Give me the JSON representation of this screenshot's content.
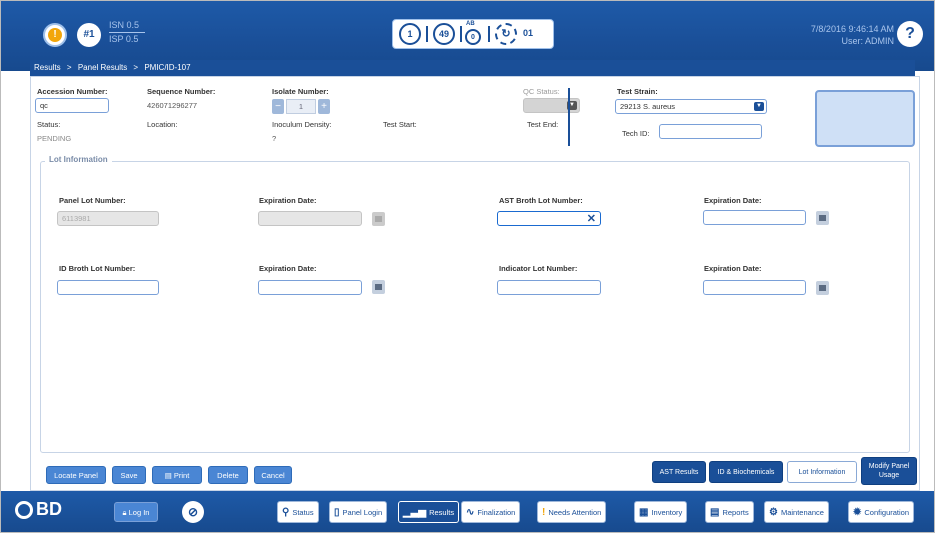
{
  "topbar": {
    "queue_number": "#1",
    "isn_label": "ISN 0.5",
    "isp_label": "ISP 0.5",
    "status_1": "1",
    "status_49": "49",
    "ab_label": "AB",
    "ab_value": "0",
    "instrument_value": "01",
    "datetime": "7/8/2016 9:46:14 AM",
    "user": "User: ADMIN",
    "help_label": "?"
  },
  "breadcrumb": [
    "Results",
    ">",
    "Panel Results",
    ">",
    "PMIC/ID-107"
  ],
  "header": {
    "accession_label": "Accession Number:",
    "accession_value": "qc",
    "sequence_label": "Sequence Number:",
    "sequence_value": "426071296277",
    "isolate_label": "Isolate Number:",
    "isolate_value": "1",
    "qc_status_label": "QC Status:",
    "test_strain_label": "Test Strain:",
    "test_strain_value": "29213  S. aureus",
    "status_label": "Status:",
    "status_value": "PENDING",
    "location_label": "Location:",
    "inoculum_label": "Inoculum Density:",
    "inoculum_value": "?",
    "test_start_label": "Test Start:",
    "test_end_label": "Test End:",
    "tech_id_label": "Tech ID:",
    "tech_id_value": ""
  },
  "lot_info": {
    "legend": "Lot Information",
    "panel_lot_label": "Panel Lot Number:",
    "panel_lot_value": "6113981",
    "exp1_label": "Expiration Date:",
    "ast_broth_label": "AST Broth Lot Number:",
    "ast_broth_value": "",
    "exp2_label": "Expiration Date:",
    "id_broth_label": "ID Broth Lot Number:",
    "exp3_label": "Expiration Date:",
    "indicator_label": "Indicator Lot Number:",
    "exp4_label": "Expiration Date:"
  },
  "actions": {
    "locate_panel": "Locate Panel",
    "save": "Save",
    "print": "Print",
    "delete": "Delete",
    "cancel": "Cancel"
  },
  "result_tabs": {
    "ast_results": "AST Results",
    "id_biochemicals": "ID & Biochemicals",
    "lot_information": "Lot Information",
    "modify_panel_usage": "Modify Panel Usage"
  },
  "footer": {
    "logo": "BD",
    "login": "Log In",
    "nav": [
      "Status",
      "Panel Login",
      "Results",
      "Finalization",
      "Needs Attention",
      "Inventory",
      "Reports",
      "Maintenance",
      "Configuration"
    ]
  }
}
